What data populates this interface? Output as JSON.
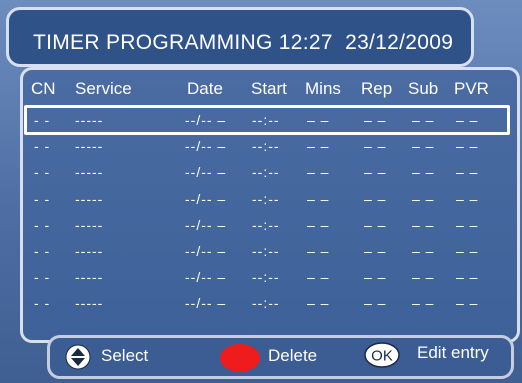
{
  "title": {
    "text": "TIMER PROGRAMMING",
    "time": "12:27",
    "date": "23/12/2009"
  },
  "columns": [
    "CN",
    "Service",
    "Date",
    "Start",
    "Mins",
    "Rep",
    "Sub",
    "PVR"
  ],
  "rows": [
    [
      "- -",
      "-----",
      "--/-- –",
      "--:--",
      "– –",
      "– –",
      "– –",
      "– –"
    ],
    [
      "- -",
      "-----",
      "--/-- –",
      "--:--",
      "– –",
      "– –",
      "– –",
      "– –"
    ],
    [
      "- -",
      "-----",
      "--/-- –",
      "--:--",
      "– –",
      "– –",
      "– –",
      "– –"
    ],
    [
      "- -",
      "-----",
      "--/-- –",
      "--:--",
      "– –",
      "– –",
      "– –",
      "– –"
    ],
    [
      "- -",
      "-----",
      "--/-- –",
      "--:--",
      "– –",
      "– –",
      "– –",
      "– –"
    ],
    [
      "- -",
      "-----",
      "--/-- –",
      "--:--",
      "– –",
      "– –",
      "– –",
      "– –"
    ],
    [
      "- -",
      "-----",
      "--/-- –",
      "--:--",
      "– –",
      "– –",
      "– –",
      "– –"
    ],
    [
      "- -",
      "-----",
      "--/-- –",
      "--:--",
      "– –",
      "– –",
      "– –",
      "– –"
    ]
  ],
  "selected_row": 0,
  "footer": {
    "select": {
      "icon": "up-down-arrows-icon",
      "label": "Select"
    },
    "delete": {
      "icon": "red-button-icon",
      "label": "Delete",
      "color": "#ee1c1c"
    },
    "edit": {
      "icon": "ok-button-icon",
      "icon_text": "OK",
      "label": "Edit entry"
    }
  }
}
